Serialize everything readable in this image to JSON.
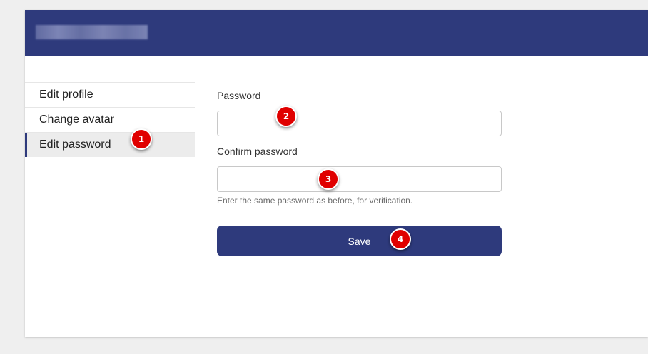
{
  "sidebar": {
    "items": [
      {
        "label": "Edit profile"
      },
      {
        "label": "Change avatar"
      },
      {
        "label": "Edit password"
      }
    ]
  },
  "form": {
    "password_label": "Password",
    "password_value": "",
    "confirm_label": "Confirm password",
    "confirm_value": "",
    "confirm_help": "Enter the same password as before, for verification.",
    "save_label": "Save"
  },
  "annotations": [
    "1",
    "2",
    "3",
    "4"
  ],
  "colors": {
    "brand": "#2e3a7c",
    "badge": "#e00000",
    "page_bg": "#efefef"
  }
}
